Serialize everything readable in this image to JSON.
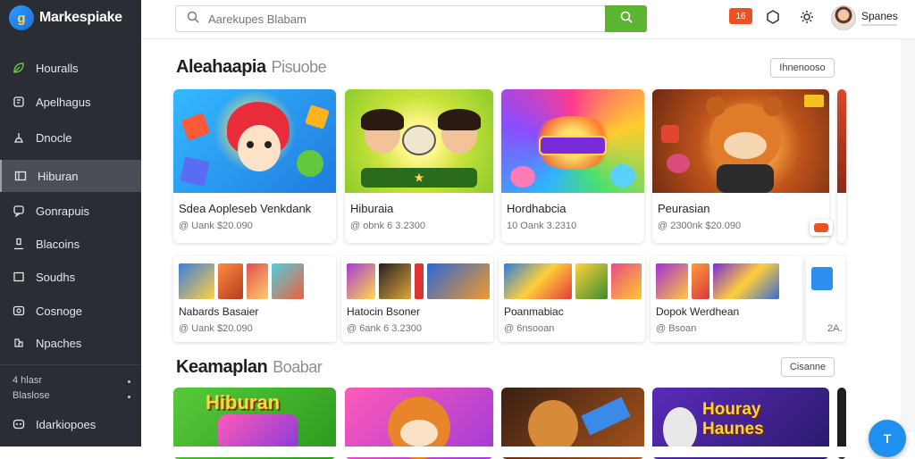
{
  "brand": {
    "logo_text": "g",
    "name": "Markespiake"
  },
  "sidebar": {
    "items": [
      {
        "label": "Houralls",
        "icon": "leaf-icon"
      },
      {
        "label": "Apelhagus",
        "icon": "book-icon"
      },
      {
        "label": "Dnocle",
        "icon": "joystick-icon"
      },
      {
        "label": "Hiburan",
        "icon": "window-icon",
        "active": true
      },
      {
        "label": "Gonrapuis",
        "icon": "chat-icon"
      },
      {
        "label": "Blacoins",
        "icon": "person-icon"
      },
      {
        "label": "Soudhs",
        "icon": "square-icon"
      },
      {
        "label": "Cosnoge",
        "icon": "gamepad-icon"
      },
      {
        "label": "Npaches",
        "icon": "puzzle-icon"
      }
    ],
    "footer_small_1": "4 hlasr",
    "footer_small_2": "Blaslose",
    "footer_item": "Idarkiopoes"
  },
  "topbar": {
    "search_placeholder": "Aarekupes Blabam",
    "notification_label": "16",
    "user_name": "Spanes"
  },
  "section1": {
    "title": "Aleahaapia",
    "subtitle": "Pisuobe",
    "button": "Ihnenooso"
  },
  "section1_cards": [
    {
      "title": "Sdea Aopleseb Venkdank",
      "meta": "@ Uank $20.090"
    },
    {
      "title": "Hiburaia",
      "meta": "@ obnk 6 3.2300"
    },
    {
      "title": "Hordhabcia",
      "meta": "10 Oank 3.2310"
    },
    {
      "title": "Peurasian",
      "meta": "@ 2300nk $20.090"
    }
  ],
  "section1_row2": [
    {
      "title": "Nabards Basaier",
      "meta": "@ Uank $20.090"
    },
    {
      "title": "Hatocin Bsoner",
      "meta": "@ 6ank 6 3.2300"
    },
    {
      "title": "Poanmabiac",
      "meta": "@ 6nsooan"
    },
    {
      "title": "Dopok Werdhean",
      "meta": "@ Bsoan"
    },
    {
      "title": "",
      "meta": "2A."
    }
  ],
  "section2": {
    "title": "Keamaplan",
    "subtitle": "Boabar",
    "button": "Cisanne"
  },
  "section2_cards": [
    {
      "art_text": "Hiburan"
    },
    {
      "art_text": ""
    },
    {
      "art_text": ""
    },
    {
      "art_text": "Houray Haunes"
    }
  ],
  "fab": {
    "label": "T"
  },
  "colors": {
    "sidebar_bg": "#2a2d33",
    "search_button": "#5cb531",
    "notification": "#e8531f",
    "fab": "#1f8ff0"
  }
}
